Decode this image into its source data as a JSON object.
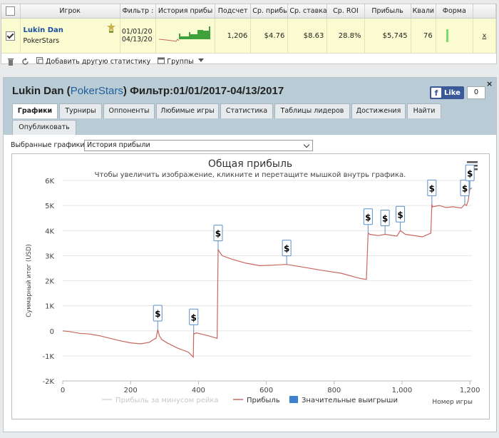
{
  "table": {
    "columns": [
      "",
      "Игрок",
      "Фильтр :",
      "История прибы",
      "Подсчет",
      "Ср. прибы",
      "Ср. ставка",
      "Ср. ROI",
      "Прибыль",
      "Квали",
      "Форма",
      ""
    ],
    "row": {
      "player": "Lukin Dan",
      "site": "PokerStars",
      "filter_from": "01/01/20",
      "filter_to": "04/13/20",
      "count": "1,206",
      "avg_profit": "$4.76",
      "avg_stake": "$8.63",
      "roi": "28.8%",
      "profit": "$5,745",
      "rating": "76",
      "close": "x"
    }
  },
  "toolbar": {
    "add_stats": "Добавить другую статистику",
    "groups": "Группы"
  },
  "detail": {
    "name": "Lukin Dan",
    "site": "PokerStars",
    "filter_label": "Фильтр:",
    "filter_range": "01/01/2017-04/13/2017",
    "like": "Like",
    "like_count": "0",
    "close": "×",
    "tabs": [
      "Графики",
      "Турниры",
      "Оппоненты",
      "Любимые игры",
      "Статистика",
      "Таблицы лидеров",
      "Достижения",
      "Найти",
      "Опубликовать"
    ],
    "selected_label": "Выбранные графики:",
    "selected_value": "История прибыли"
  },
  "chart_data": {
    "type": "line",
    "title": "Общая прибыль",
    "subtitle": "Чтобы увеличить изображение, кликните и перетащите мышкой внутрь графика.",
    "xlabel": "Номер игры",
    "ylabel": "Суммарный итог (USD)",
    "xlim": [
      0,
      1206
    ],
    "ylim": [
      -2000,
      6000
    ],
    "x_ticks": [
      "0",
      "200",
      "400",
      "600",
      "800",
      "1,000",
      "1,200"
    ],
    "y_ticks": [
      "6K",
      "5K",
      "4K",
      "3K",
      "2K",
      "1K",
      "0",
      "-1K",
      "-2K"
    ],
    "legend": [
      "Прибыль за минусом рейка",
      "Прибыль",
      "Значительные выигрыши"
    ],
    "series": [
      {
        "name": "Прибыль",
        "color": "#c9665f",
        "x": [
          0,
          20,
          50,
          80,
          110,
          140,
          170,
          200,
          230,
          255,
          270,
          275,
          280,
          285,
          292,
          310,
          340,
          370,
          385,
          386,
          389,
          393,
          400,
          430,
          455,
          458,
          462,
          470,
          500,
          540,
          580,
          620,
          660,
          700,
          760,
          820,
          860,
          880,
          895,
          900,
          905,
          930,
          950,
          985,
          995,
          1010,
          1060,
          1085,
          1088,
          1090,
          1110,
          1130,
          1150,
          1175,
          1185,
          1190,
          1195,
          1200,
          1206
        ],
        "values": [
          0,
          -30,
          -100,
          -130,
          -200,
          -300,
          -400,
          -480,
          -520,
          -460,
          -330,
          -300,
          50,
          -200,
          -350,
          -500,
          -700,
          -850,
          -1050,
          -100,
          -120,
          -80,
          -100,
          -200,
          -300,
          3250,
          3150,
          3000,
          2850,
          2700,
          2600,
          2620,
          2650,
          2560,
          2420,
          2300,
          2150,
          2080,
          2050,
          3900,
          3850,
          3800,
          3850,
          3780,
          4000,
          3850,
          3750,
          3900,
          5050,
          4950,
          5000,
          4920,
          4950,
          4900,
          5050,
          5000,
          5200,
          5650,
          5700
        ]
      },
      {
        "name": "Прибыль за минусом рейка",
        "color": "#d4d4d4",
        "values": []
      }
    ],
    "big_wins": [
      {
        "x": 280,
        "y": 50
      },
      {
        "x": 386,
        "y": -100
      },
      {
        "x": 458,
        "y": 3250
      },
      {
        "x": 660,
        "y": 2650
      },
      {
        "x": 900,
        "y": 3900
      },
      {
        "x": 950,
        "y": 3850
      },
      {
        "x": 995,
        "y": 4000
      },
      {
        "x": 1088,
        "y": 5050
      },
      {
        "x": 1185,
        "y": 5050
      },
      {
        "x": 1200,
        "y": 5650
      }
    ],
    "big_win_label": "$",
    "grid": true,
    "legend_position": "bottom"
  }
}
